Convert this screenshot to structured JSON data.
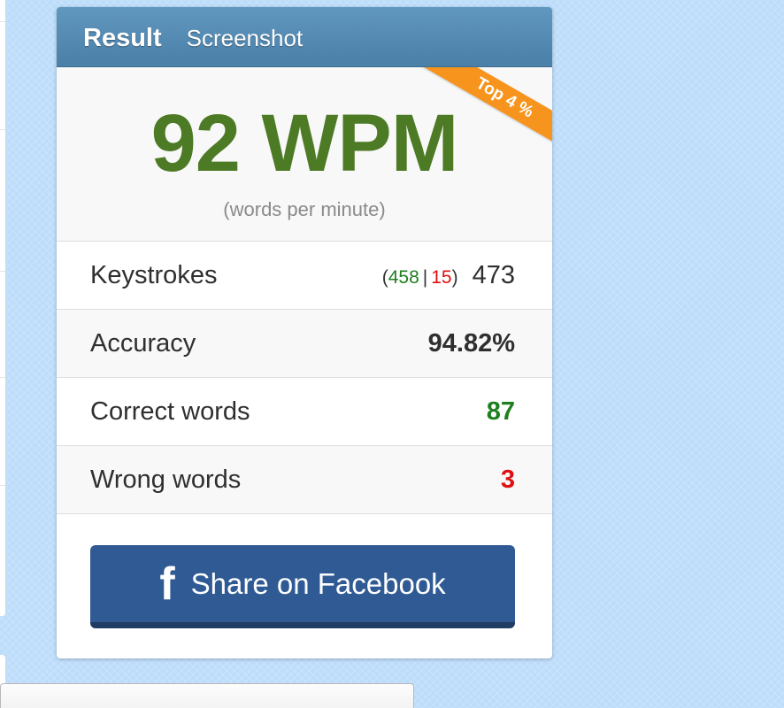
{
  "tabs": [
    {
      "label": "Result",
      "active": true
    },
    {
      "label": "Screenshot",
      "active": false
    }
  ],
  "badge": {
    "label": "Top 4 %",
    "color": "#f7941d"
  },
  "wpm": {
    "value": "92 WPM",
    "caption": "(words per minute)",
    "color": "#4d7a24"
  },
  "stats": {
    "keystrokes": {
      "label": "Keystrokes",
      "open": "(",
      "correct": "458",
      "separator": "|",
      "wrong": "15",
      "close": ")",
      "total": "473"
    },
    "accuracy": {
      "label": "Accuracy",
      "value": "94.82%"
    },
    "correct_words": {
      "label": "Correct words",
      "value": "87"
    },
    "wrong_words": {
      "label": "Wrong words",
      "value": "3"
    }
  },
  "share": {
    "label": "Share on Facebook",
    "icon": "facebook-icon",
    "icon_glyph": "f",
    "color": "#2f5a94"
  },
  "colors": {
    "header": "#4a7fa7",
    "background": "#bcdcfa",
    "positive": "#1e7f1e",
    "negative": "#e01010"
  }
}
